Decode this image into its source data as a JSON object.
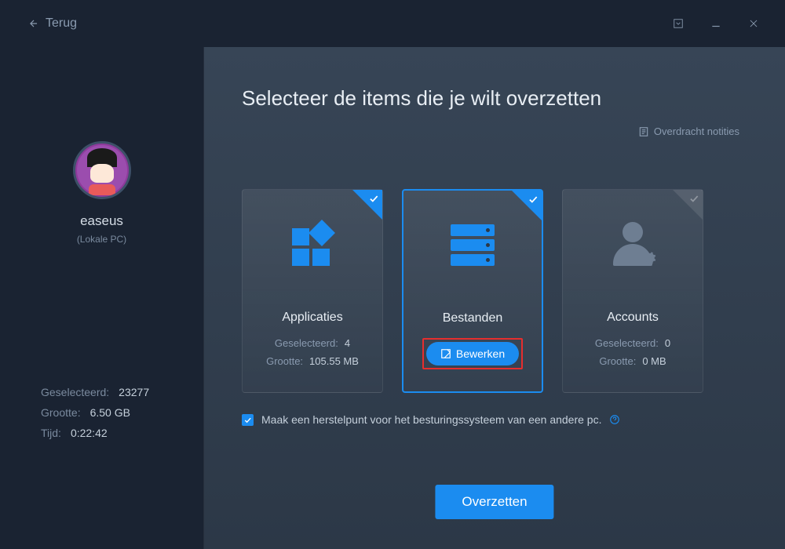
{
  "titlebar": {
    "back": "Terug"
  },
  "sidebar": {
    "username": "easeus",
    "userlabel": "(Lokale PC)",
    "stats": {
      "selected_label": "Geselecteerd:",
      "selected_value": "23277",
      "size_label": "Grootte:",
      "size_value": "6.50 GB",
      "time_label": "Tijd:",
      "time_value": "0:22:42"
    }
  },
  "content": {
    "title": "Selecteer de items die je wilt overzetten",
    "notes_link": "Overdracht notities",
    "cards": {
      "apps": {
        "title": "Applicaties",
        "selected_label": "Geselecteerd:",
        "selected_value": "4",
        "size_label": "Grootte:",
        "size_value": "105.55 MB"
      },
      "files": {
        "title": "Bestanden",
        "edit_label": "Bewerken"
      },
      "accounts": {
        "title": "Accounts",
        "selected_label": "Geselecteerd:",
        "selected_value": "0",
        "size_label": "Grootte:",
        "size_value": "0 MB"
      }
    },
    "restore_label": "Maak een herstelpunt voor het besturingssysteem van een andere pc.",
    "transfer_button": "Overzetten"
  }
}
